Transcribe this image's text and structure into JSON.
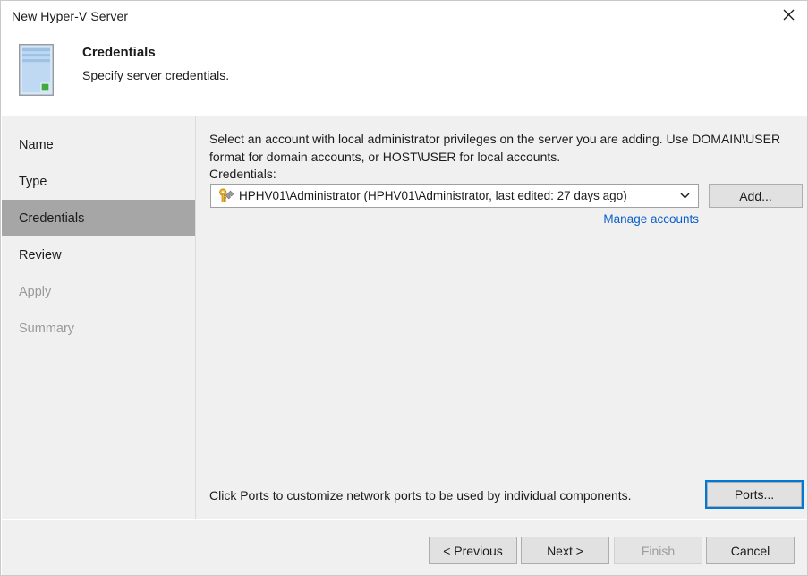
{
  "window": {
    "title": "New Hyper-V Server",
    "close_icon": "close-icon"
  },
  "header": {
    "icon": "server-icon",
    "title": "Credentials",
    "subtitle": "Specify server credentials."
  },
  "sidebar": {
    "items": [
      {
        "label": "Name",
        "state": "normal"
      },
      {
        "label": "Type",
        "state": "normal"
      },
      {
        "label": "Credentials",
        "state": "selected"
      },
      {
        "label": "Review",
        "state": "normal"
      },
      {
        "label": "Apply",
        "state": "disabled"
      },
      {
        "label": "Summary",
        "state": "disabled"
      }
    ]
  },
  "content": {
    "intro": "Select an account with local administrator privileges on the server you are adding. Use DOMAIN\\USER format for domain accounts, or HOST\\USER for local accounts.",
    "credentials_label": "Credentials:",
    "credentials_combo": {
      "icon": "key-wrench-icon",
      "value": "HPHV01\\Administrator (HPHV01\\Administrator, last edited: 27 days ago)",
      "arrow_icon": "chevron-down-icon"
    },
    "add_button": "Add...",
    "manage_link": "Manage accounts",
    "ports_note": "Click Ports to customize network ports to be used by individual components.",
    "ports_button": "Ports..."
  },
  "footer": {
    "previous": "< Previous",
    "next": "Next >",
    "finish": "Finish",
    "cancel": "Cancel"
  },
  "colors": {
    "accent": "#0078d7",
    "link": "#0b5fc8",
    "selected_nav": "#a6a6a6",
    "panel": "#f0f0f0",
    "key_gold": "#f5bc42",
    "status_green": "#3faa3f"
  }
}
